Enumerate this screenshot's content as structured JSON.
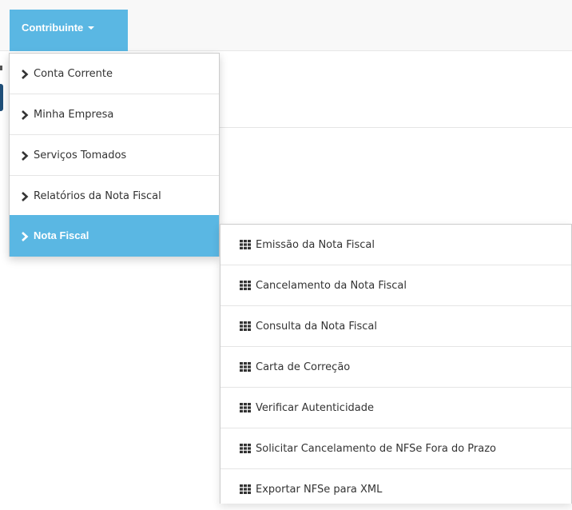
{
  "navbar": {
    "menu_label": "Contribuinte",
    "accent_color": "#5ab7e3"
  },
  "menu": {
    "items": [
      {
        "label": "Conta Corrente",
        "icon": "chevron-right-icon"
      },
      {
        "label": "Minha Empresa",
        "icon": "chevron-right-icon"
      },
      {
        "label": "Serviços Tomados",
        "icon": "chevron-right-icon"
      },
      {
        "label": "Relatórios da Nota Fiscal",
        "icon": "chevron-right-icon"
      },
      {
        "label": "Nota Fiscal",
        "icon": "chevron-right-icon",
        "active": true
      }
    ]
  },
  "submenu": {
    "items": [
      {
        "label": "Emissão da Nota Fiscal",
        "icon": "grid-icon"
      },
      {
        "label": "Cancelamento da Nota Fiscal",
        "icon": "grid-icon"
      },
      {
        "label": "Consulta da Nota Fiscal",
        "icon": "grid-icon"
      },
      {
        "label": "Carta de Correção",
        "icon": "grid-icon"
      },
      {
        "label": "Verificar Autenticidade",
        "icon": "grid-icon"
      },
      {
        "label": "Solicitar Cancelamento de NFSe Fora do Prazo",
        "icon": "grid-icon"
      },
      {
        "label": "Exportar NFSe para XML",
        "icon": "grid-icon"
      }
    ]
  }
}
